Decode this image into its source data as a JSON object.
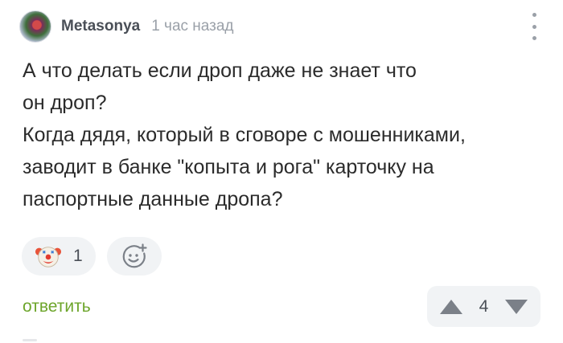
{
  "comment": {
    "author": "Metasonya",
    "time": "1 час назад",
    "lines": [
      "А что делать если дроп даже не знает что",
      "он дроп?",
      "Когда дядя, который в сговоре с мошенниками,",
      "заводит в банке \"копыта и рога\" карточку на",
      "паспортные данные дропа?"
    ]
  },
  "reactions": {
    "items": [
      {
        "icon": "clown-face-icon",
        "count": "1"
      }
    ],
    "add_icon": "add-reaction-icon"
  },
  "actions": {
    "reply_label": "ответить"
  },
  "rating": {
    "value": "4"
  },
  "colors": {
    "accent_green": "#6da52b",
    "muted": "#9aa0a8",
    "pill_bg": "#f1f3f5"
  }
}
